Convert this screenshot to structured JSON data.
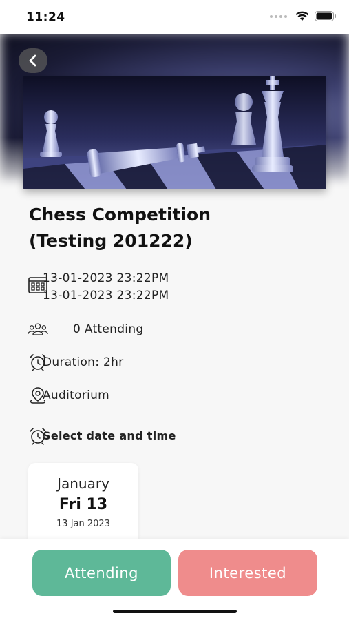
{
  "status_bar": {
    "time": "11:24"
  },
  "event": {
    "title_line1": "Chess Competition",
    "title_line2": "(Testing 201222)",
    "start": "13-01-2023 23:22PM",
    "end": "13-01-2023 23:22PM",
    "attending": "0 Attending",
    "duration": "Duration: 2hr",
    "location": "Auditorium",
    "select_label": "Select date and time"
  },
  "date_card": {
    "month": "January",
    "day": "Fri 13",
    "full": "13 Jan 2023"
  },
  "actions": {
    "attending_label": "Attending",
    "interested_label": "Interested"
  },
  "colors": {
    "attending": "#5eb898",
    "interested": "#ef8c8c"
  },
  "icons": {
    "back": "chevron-left-icon",
    "calendar": "calendar-icon",
    "people": "people-icon",
    "clock": "alarm-clock-icon",
    "location": "map-pin-icon"
  }
}
